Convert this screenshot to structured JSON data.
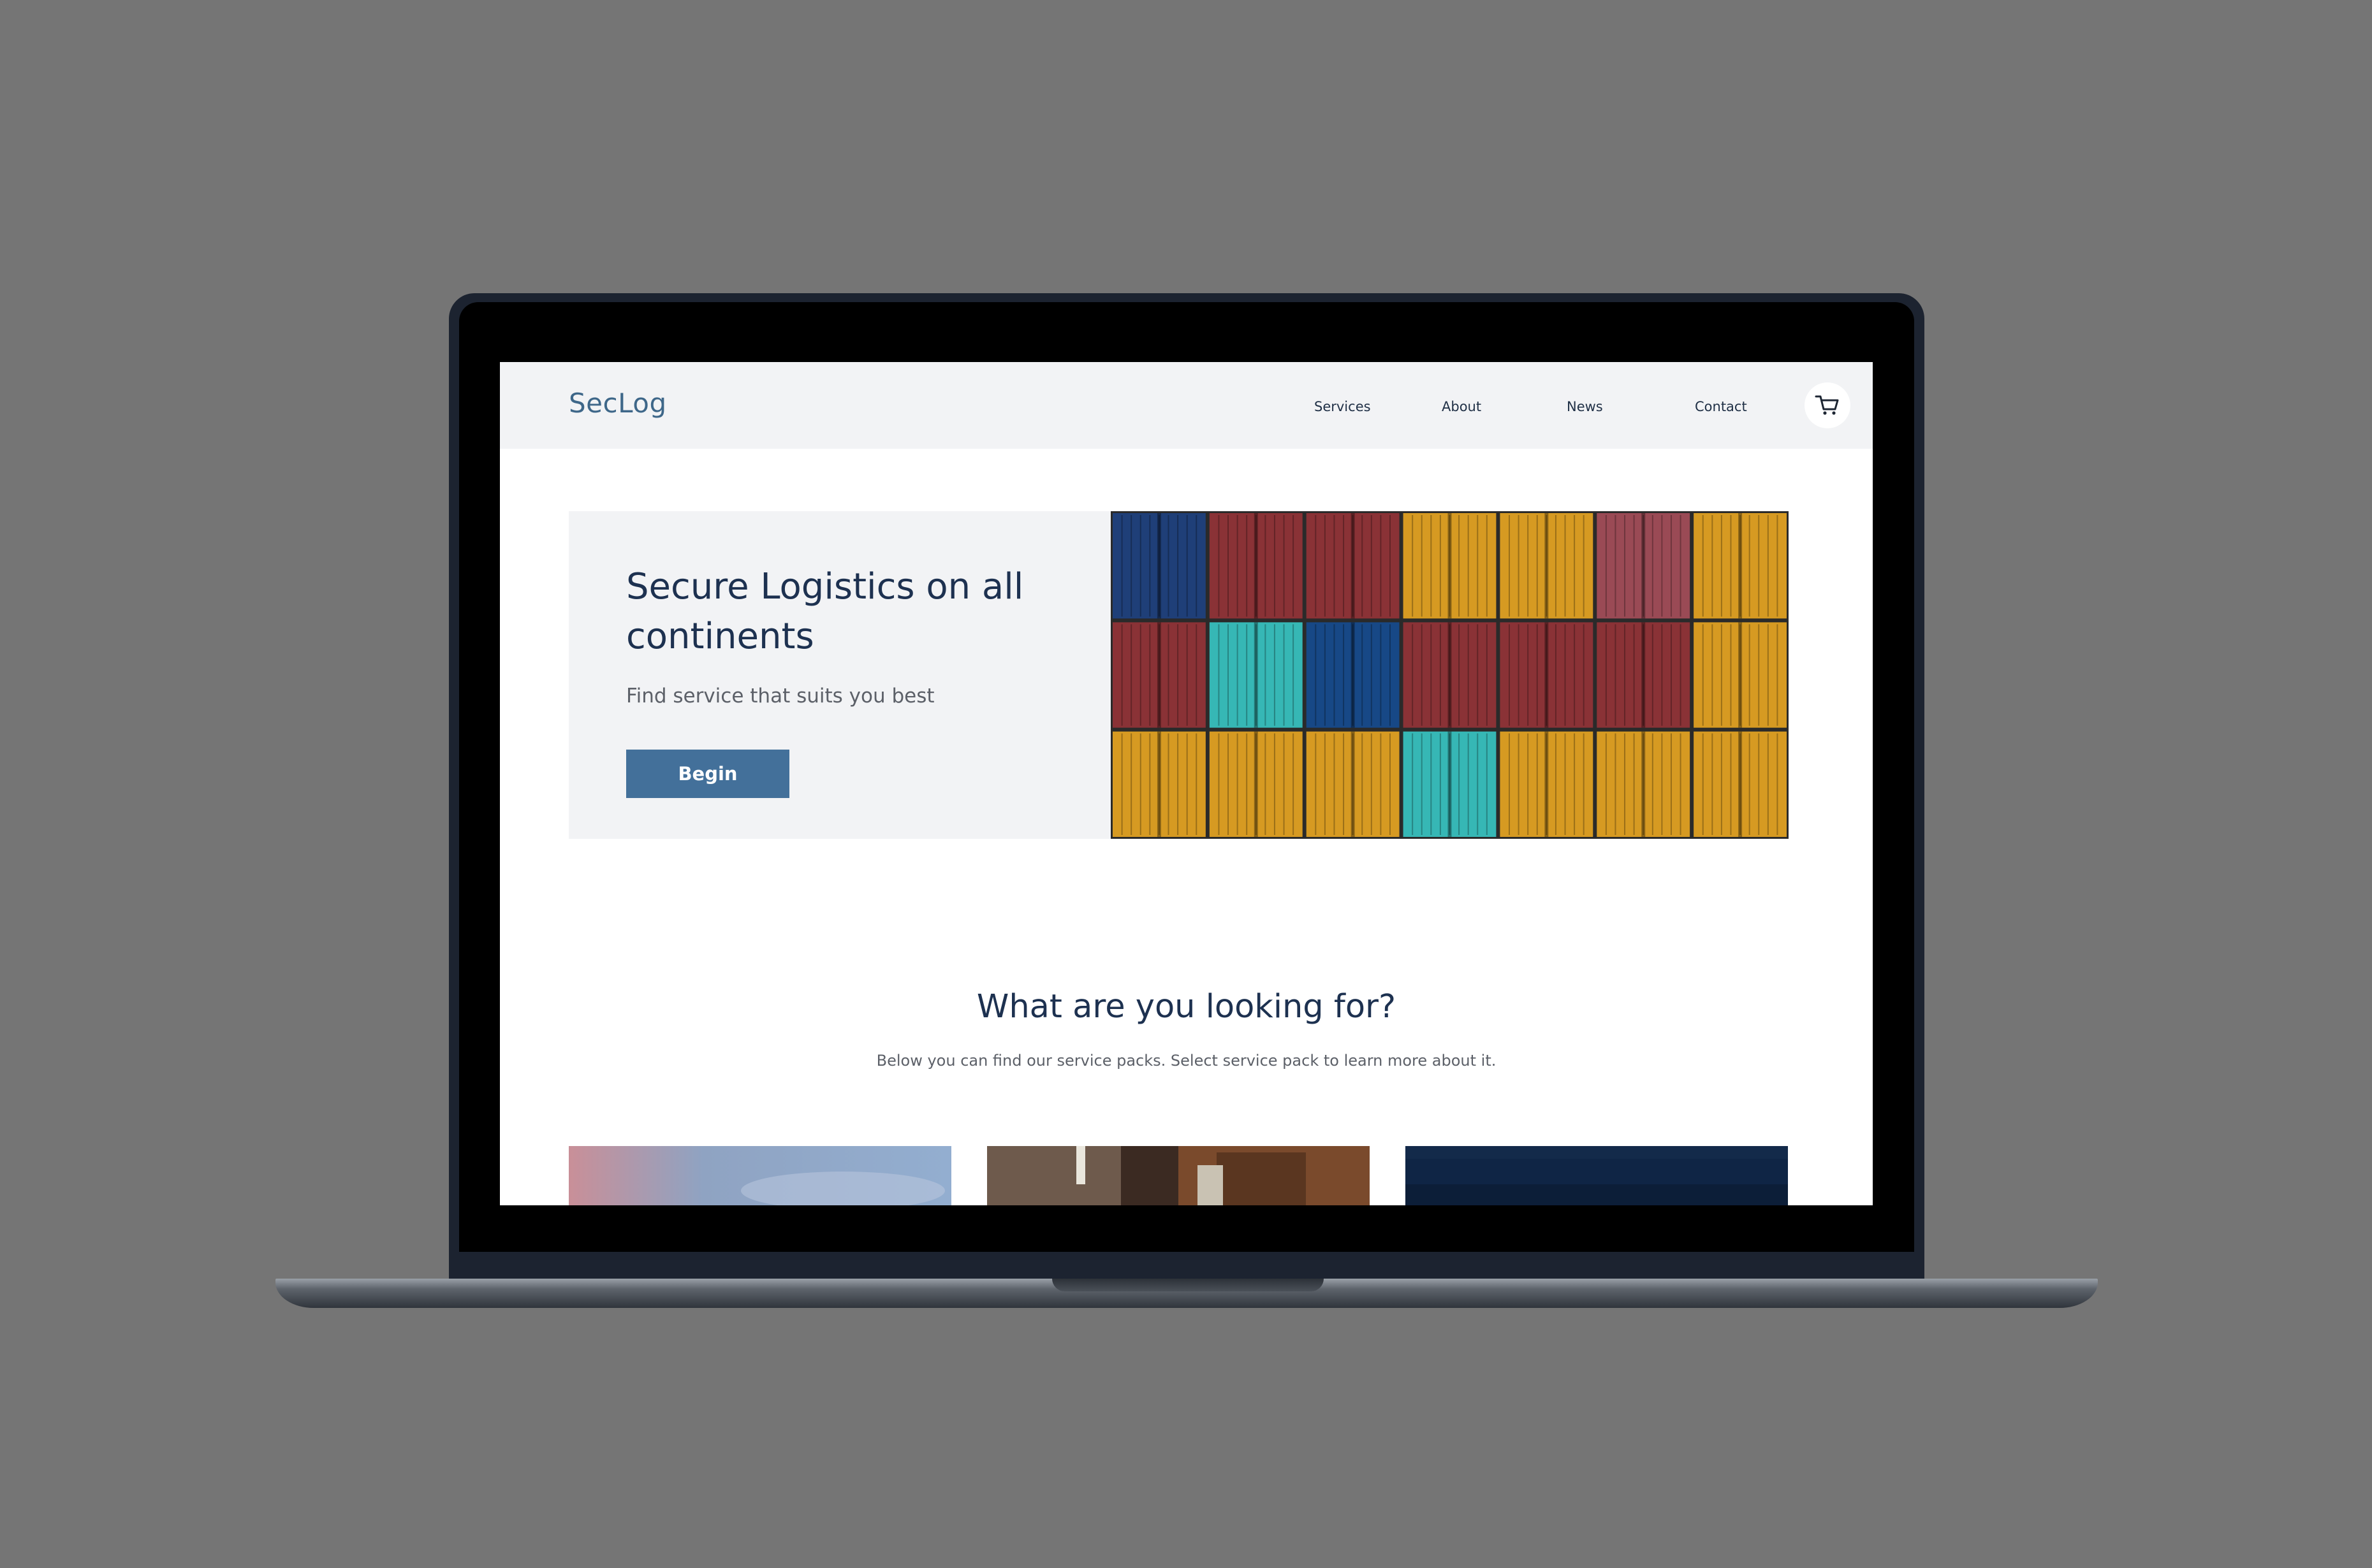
{
  "site": {
    "logo": "SecLog",
    "nav": [
      "Services",
      "About",
      "News",
      "Contact"
    ],
    "cart_icon": "shopping-cart-icon"
  },
  "hero": {
    "title": "Secure Logistics on all continents",
    "subtitle": "Find service that suits you best",
    "button": "Begin",
    "image": "stacked-shipping-containers-photo"
  },
  "services": {
    "title": "What are you looking for?",
    "description": "Below you can find our service packs. Select service pack to learn more about it.",
    "cards": [
      "sky-photo",
      "warehouse-photo",
      "ocean-photo"
    ]
  },
  "colors": {
    "accent": "#43709a",
    "heading": "#1d3150",
    "header_bg": "#f2f3f5",
    "backdrop": "#757575"
  }
}
